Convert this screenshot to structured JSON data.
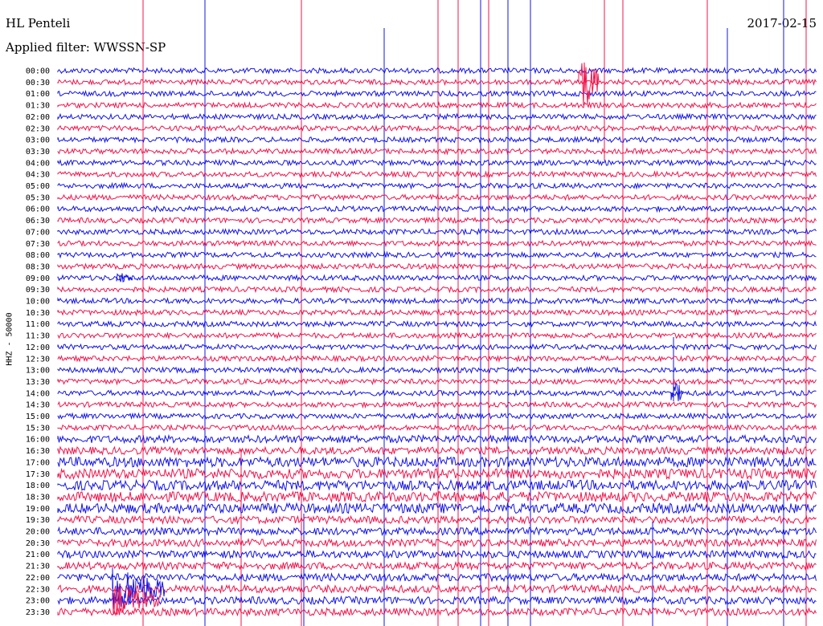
{
  "header": {
    "station": "HL Penteli",
    "date": "2017-02-15",
    "filter_label": "Applied filter: WWSSN-SP"
  },
  "chart_data": {
    "type": "line",
    "title": "HL Penteli",
    "date": "2017-02-15",
    "ylabel": "HHZ - 50000",
    "row_labels": [
      "00:00",
      "00:30",
      "01:00",
      "01:30",
      "02:00",
      "02:30",
      "03:00",
      "03:30",
      "04:00",
      "04:30",
      "05:00",
      "05:30",
      "06:00",
      "06:30",
      "07:00",
      "07:30",
      "08:00",
      "08:30",
      "09:00",
      "09:30",
      "10:00",
      "10:30",
      "11:00",
      "11:30",
      "12:00",
      "12:30",
      "13:00",
      "13:30",
      "14:00",
      "14:30",
      "15:00",
      "15:30",
      "16:00",
      "16:30",
      "17:00",
      "17:30",
      "18:00",
      "18:30",
      "19:00",
      "19:30",
      "20:00",
      "20:30",
      "21:00",
      "21:30",
      "22:00",
      "22:30",
      "23:00",
      "23:30"
    ],
    "colors": {
      "trace_a": "#1414e6",
      "trace_b": "#f0144c"
    },
    "grid": false
  }
}
